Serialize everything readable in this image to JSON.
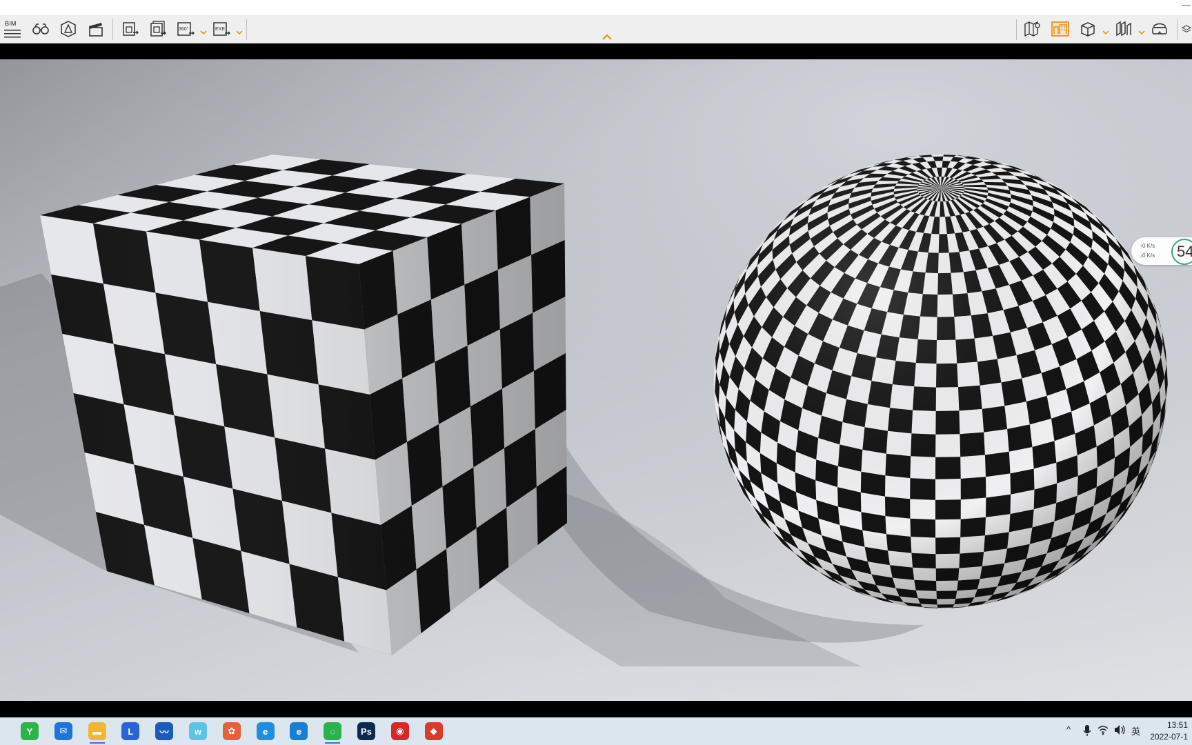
{
  "toolbar": {
    "bim_label": "BIM",
    "left_tools": [
      {
        "id": "menu",
        "icon": "hamburger-menu-icon"
      },
      {
        "id": "walk",
        "icon": "binoculars-icon"
      },
      {
        "id": "markup",
        "icon": "pyramid-icon"
      },
      {
        "id": "animation",
        "icon": "clapperboard-icon"
      },
      {
        "id": "export-image",
        "icon": "export-image-icon"
      },
      {
        "id": "export-batch",
        "icon": "export-batch-icon"
      },
      {
        "id": "export-360",
        "icon": "export-360-icon",
        "badge": "360°"
      },
      {
        "id": "export-exe",
        "icon": "export-exe-icon",
        "badge": "EXE"
      }
    ],
    "right_tools": [
      {
        "id": "map",
        "icon": "map-pin-icon"
      },
      {
        "id": "building",
        "icon": "building-icon",
        "active": true
      },
      {
        "id": "cube-view",
        "icon": "cube-icon"
      },
      {
        "id": "section",
        "icon": "section-icon"
      },
      {
        "id": "vr",
        "icon": "vr-headset-icon"
      },
      {
        "id": "layers",
        "icon": "layers-icon"
      }
    ],
    "accent_color": "#e8890c"
  },
  "net_widget": {
    "upload": "↑0 K/s",
    "download": "↓0 K/s",
    "percent": "54"
  },
  "taskbar": {
    "apps": [
      {
        "name": "green-app-icon",
        "color": "#2db34a",
        "glyph": "Y"
      },
      {
        "name": "mail-icon",
        "color": "#1e74d8",
        "glyph": "✉"
      },
      {
        "name": "file-explorer-icon",
        "color": "#f2b632",
        "glyph": "▬"
      },
      {
        "name": "blue-l-app-icon",
        "color": "#2a63d6",
        "glyph": "L"
      },
      {
        "name": "chart-app-icon",
        "color": "#1d5bb9",
        "glyph": "〰"
      },
      {
        "name": "w-app-icon",
        "color": "#58c4e8",
        "glyph": "w"
      },
      {
        "name": "colorful-app-icon",
        "color": "#e7603a",
        "glyph": "✿"
      },
      {
        "name": "ie-browser-icon",
        "color": "#1e8fe0",
        "glyph": "e"
      },
      {
        "name": "edge-browser-icon",
        "color": "#1a7fd4",
        "glyph": "e"
      },
      {
        "name": "wechat-icon",
        "color": "#2ab24b",
        "glyph": "◌"
      },
      {
        "name": "photoshop-icon",
        "color": "#0d2a4d",
        "glyph": "Ps"
      },
      {
        "name": "netease-music-icon",
        "color": "#d8262b",
        "glyph": "◉"
      },
      {
        "name": "sketchup-icon",
        "color": "#d83a2f",
        "glyph": "◆"
      }
    ],
    "tray": {
      "chevron": "^",
      "ime": "英"
    },
    "time": "13:51",
    "date": "2022-07-1"
  }
}
